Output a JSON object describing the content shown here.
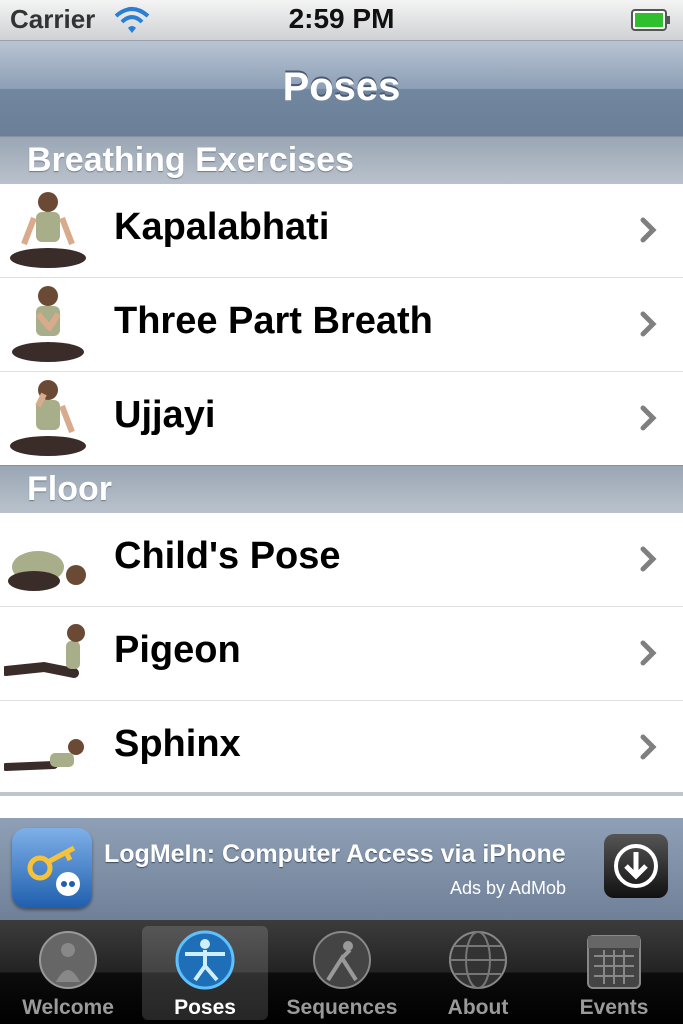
{
  "status": {
    "carrier": "Carrier",
    "time": "2:59 PM"
  },
  "nav": {
    "title": "Poses"
  },
  "sections": [
    {
      "title": "Breathing Exercises",
      "rows": [
        {
          "label": "Kapalabhati",
          "pose": "seated"
        },
        {
          "label": "Three Part Breath",
          "pose": "seated"
        },
        {
          "label": "Ujjayi",
          "pose": "seated"
        }
      ]
    },
    {
      "title": "Floor",
      "rows": [
        {
          "label": "Child's Pose",
          "pose": "childs"
        },
        {
          "label": "Pigeon",
          "pose": "pigeon"
        },
        {
          "label": "Sphinx",
          "pose": "sphinx"
        }
      ]
    }
  ],
  "ad": {
    "title": "LogMeIn: Computer Access via iPhone",
    "by": "Ads by AdMob"
  },
  "tabs": [
    {
      "label": "Welcome",
      "icon": "welcome-icon",
      "active": false
    },
    {
      "label": "Poses",
      "icon": "poses-icon",
      "active": true
    },
    {
      "label": "Sequences",
      "icon": "sequences-icon",
      "active": false
    },
    {
      "label": "About",
      "icon": "about-icon",
      "active": false
    },
    {
      "label": "Events",
      "icon": "events-icon",
      "active": false
    }
  ],
  "colors": {
    "tab_active_icon": "#3fa9f5",
    "tab_inactive": "#9a9a9a",
    "nav_bar": "#7f92ab"
  }
}
